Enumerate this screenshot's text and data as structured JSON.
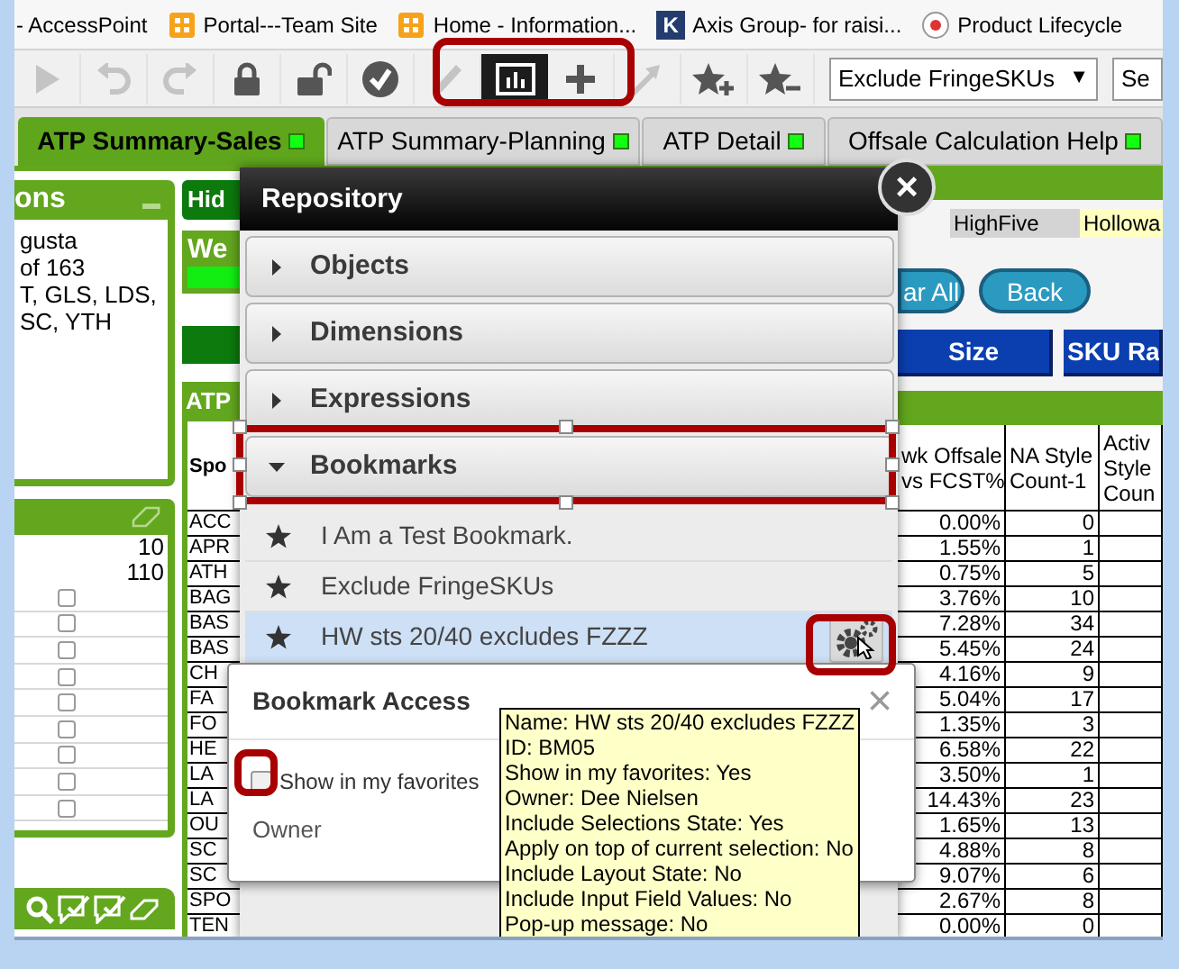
{
  "browser_bookmarks": [
    {
      "kind": "none",
      "label": "- AccessPoint"
    },
    {
      "kind": "portal",
      "label": "Portal---Team Site"
    },
    {
      "kind": "portal",
      "label": "Home - Information..."
    },
    {
      "kind": "letter",
      "icon_glyph": "K",
      "label": "Axis Group- for raisi..."
    },
    {
      "kind": "round",
      "label": "Product Lifecycle"
    }
  ],
  "toolbar": {
    "buttons": [
      {
        "kind": "play",
        "disabled": true,
        "selected": false
      },
      {
        "kind": "undo",
        "disabled": true,
        "selected": false
      },
      {
        "kind": "redo",
        "disabled": true,
        "selected": false
      },
      {
        "kind": "lock",
        "disabled": false,
        "selected": false
      },
      {
        "kind": "unlock",
        "disabled": false,
        "selected": false
      },
      {
        "kind": "check",
        "disabled": false,
        "selected": false
      },
      {
        "kind": "pencil",
        "disabled": true,
        "selected": false
      },
      {
        "kind": "chart",
        "disabled": false,
        "selected": true
      },
      {
        "kind": "plus",
        "disabled": false,
        "selected": false
      },
      {
        "kind": "arrow",
        "disabled": true,
        "selected": false
      },
      {
        "kind": "star-plus",
        "disabled": false,
        "selected": false
      },
      {
        "kind": "star-minus",
        "disabled": false,
        "selected": false
      }
    ],
    "bookmark_select": {
      "value": "Exclude FringeSKUs",
      "arrow": "▼"
    },
    "search_field": {
      "value": "Se"
    }
  },
  "tabs": [
    {
      "label": "ATP Summary-Sales",
      "selected": true
    },
    {
      "label": "ATP Summary-Planning",
      "selected": false
    },
    {
      "label": "ATP Detail",
      "selected": false
    },
    {
      "label": "Offsale Calculation Help",
      "selected": false
    }
  ],
  "left_panel": {
    "title": "ons",
    "lines": [
      "gusta",
      "of 163",
      "T, GLS, LDS,",
      "SC, YTH"
    ]
  },
  "left_list": {
    "values": [
      "10",
      "110"
    ],
    "checkboxes": [
      {
        "checked": false
      },
      {
        "checked": false
      },
      {
        "checked": false
      },
      {
        "checked": false
      },
      {
        "checked": false
      },
      {
        "checked": false
      },
      {
        "checked": false
      },
      {
        "checked": false
      },
      {
        "checked": false
      }
    ]
  },
  "middle": {
    "hide_button": "Hid",
    "panel_title": "We",
    "table_title": "ATP",
    "column_header": "Spo",
    "cells": [
      "ACC",
      "APR",
      "ATH",
      "BAG",
      "BAS",
      "BAS",
      "CH",
      "FA",
      "FO",
      "HE",
      "LA",
      "LA",
      "OU",
      "SC",
      "SC",
      "SPO",
      "TEN"
    ]
  },
  "right": {
    "filter_cells": [
      {
        "label": "HighFive",
        "color": "#d4d4d4"
      },
      {
        "label": "Hollowa",
        "color": "#ffffc0"
      }
    ],
    "buttons": [
      "ar All",
      "Back"
    ],
    "field_buttons": [
      "Size",
      "SKU Ra"
    ],
    "columns": [
      {
        "header_lines": [
          "wk Offsale",
          "vs FCST%"
        ]
      },
      {
        "header_lines": [
          "NA Style",
          "Count-1"
        ]
      },
      {
        "header_lines": [
          "Activ",
          "Style",
          "Coun"
        ]
      }
    ],
    "rows": [
      [
        "0.00%",
        "0"
      ],
      [
        "1.55%",
        "1"
      ],
      [
        "0.75%",
        "5"
      ],
      [
        "3.76%",
        "10"
      ],
      [
        "7.28%",
        "34"
      ],
      [
        "5.45%",
        "24"
      ],
      [
        "4.16%",
        "9"
      ],
      [
        "5.04%",
        "17"
      ],
      [
        "1.35%",
        "3"
      ],
      [
        "6.58%",
        "22"
      ],
      [
        "3.50%",
        "1"
      ],
      [
        "14.43%",
        "23"
      ],
      [
        "1.65%",
        "13"
      ],
      [
        "4.88%",
        "8"
      ],
      [
        "9.07%",
        "6"
      ],
      [
        "2.67%",
        "8"
      ],
      [
        "0.00%",
        "0"
      ]
    ]
  },
  "repository": {
    "title": "Repository",
    "sections": [
      {
        "label": "Objects",
        "expanded": false
      },
      {
        "label": "Dimensions",
        "expanded": false
      },
      {
        "label": "Expressions",
        "expanded": false
      },
      {
        "label": "Bookmarks",
        "expanded": true
      }
    ],
    "bookmarks": [
      {
        "label": "I Am a Test Bookmark.",
        "selected": false
      },
      {
        "label": "Exclude FringeSKUs",
        "selected": false
      },
      {
        "label": "HW sts 20/40 excludes FZZZ",
        "selected": true
      }
    ]
  },
  "bookmark_access": {
    "title": "Bookmark Access",
    "close": "×",
    "show_in_favorites": {
      "label": "Show in my favorites",
      "checked": false
    },
    "owner_label": "Owner"
  },
  "tooltip": {
    "lines": [
      "Name: HW sts 20/40 excludes FZZZ",
      "ID: BM05",
      "Show in my favorites: Yes",
      "Owner: Dee Nielsen",
      "Include Selections State: Yes",
      "Apply on top of current selection: No",
      "Include Layout State: No",
      "Include Input Field Values: No",
      "Pop-up message: No"
    ]
  }
}
